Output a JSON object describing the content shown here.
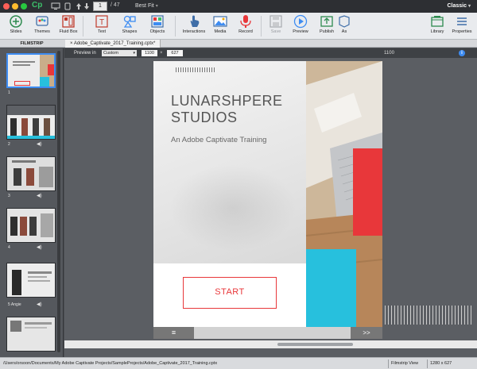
{
  "titlebar": {
    "app_logo": "Cp",
    "slide_current": "1",
    "slide_total": "/ 47",
    "zoom": "Best Fit",
    "workspace": "Classic"
  },
  "ribbon": {
    "slides": "Slides",
    "themes": "Themes",
    "fluid_box": "Fluid Box",
    "text": "Text",
    "shapes": "Shapes",
    "objects": "Objects",
    "interactions": "Interactions",
    "media": "Media",
    "record": "Record",
    "save": "Save",
    "preview": "Preview",
    "publish": "Publish",
    "assets": "As",
    "library": "Library",
    "properties": "Properties"
  },
  "tabs": {
    "filmstrip_title": "FILMSTRIP",
    "doc_tab": "× Adobe_Captivate_2017_Training.cptx*"
  },
  "filmstrip": {
    "labels": [
      "1",
      "2",
      "3",
      "4",
      "5 Angie",
      ""
    ]
  },
  "preview": {
    "label": "Preview in",
    "device": "Custom",
    "width": "1100",
    "x": "×",
    "height": "627",
    "ruler_value": "1100"
  },
  "slide": {
    "title": "LUNARSHPERE STUDIOS",
    "subtitle": "An Adobe Captivate Training",
    "start_label": "START",
    "menu_glyph": "≡",
    "next_label": ">>"
  },
  "status": {
    "path": "/Users/orsoon/Documents/My Adobe Captivate Projects/SampleProjects/Adobe_Captivate_2017_Training.cptx",
    "view": "Filmstrip View",
    "dims": "1280 x 627"
  },
  "colors": {
    "accent_red": "#e8373a",
    "accent_cyan": "#27c0dd",
    "selection_blue": "#3d8cf2",
    "logo_green": "#3cc06a"
  }
}
